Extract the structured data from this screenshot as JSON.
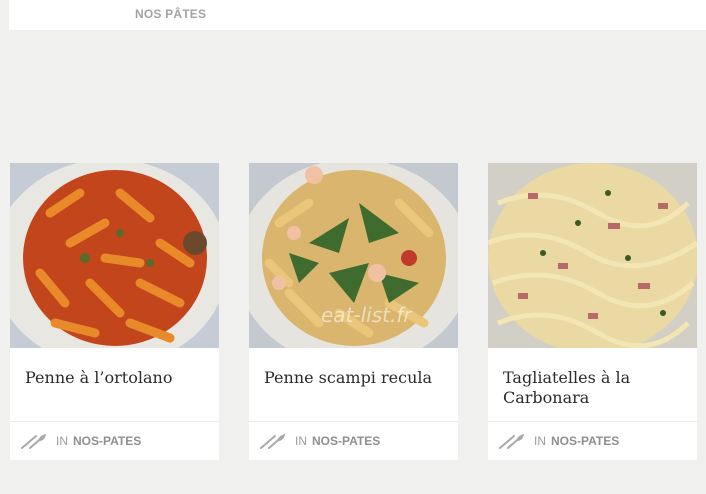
{
  "top": {
    "category": "NOS PÂTES"
  },
  "cards": [
    {
      "title": "Penne à l’ortolano",
      "in_label": "IN",
      "category": "NOS-PATES",
      "image": "penne-ortolano-photo"
    },
    {
      "title": "Penne scampi recula",
      "in_label": "IN",
      "category": "NOS-PATES",
      "image": "penne-scampi-photo",
      "watermark": "eat-list.fr"
    },
    {
      "title": "Tagliatelles à la Carbonara",
      "in_label": "IN",
      "category": "NOS-PATES",
      "image": "tagliatelles-carbonara-photo"
    }
  ],
  "icons": {
    "meta": "fork-knife-icon"
  },
  "colors": {
    "background": "#f0f0ef",
    "card": "#ffffff",
    "category_text": "#8f8f8f"
  }
}
